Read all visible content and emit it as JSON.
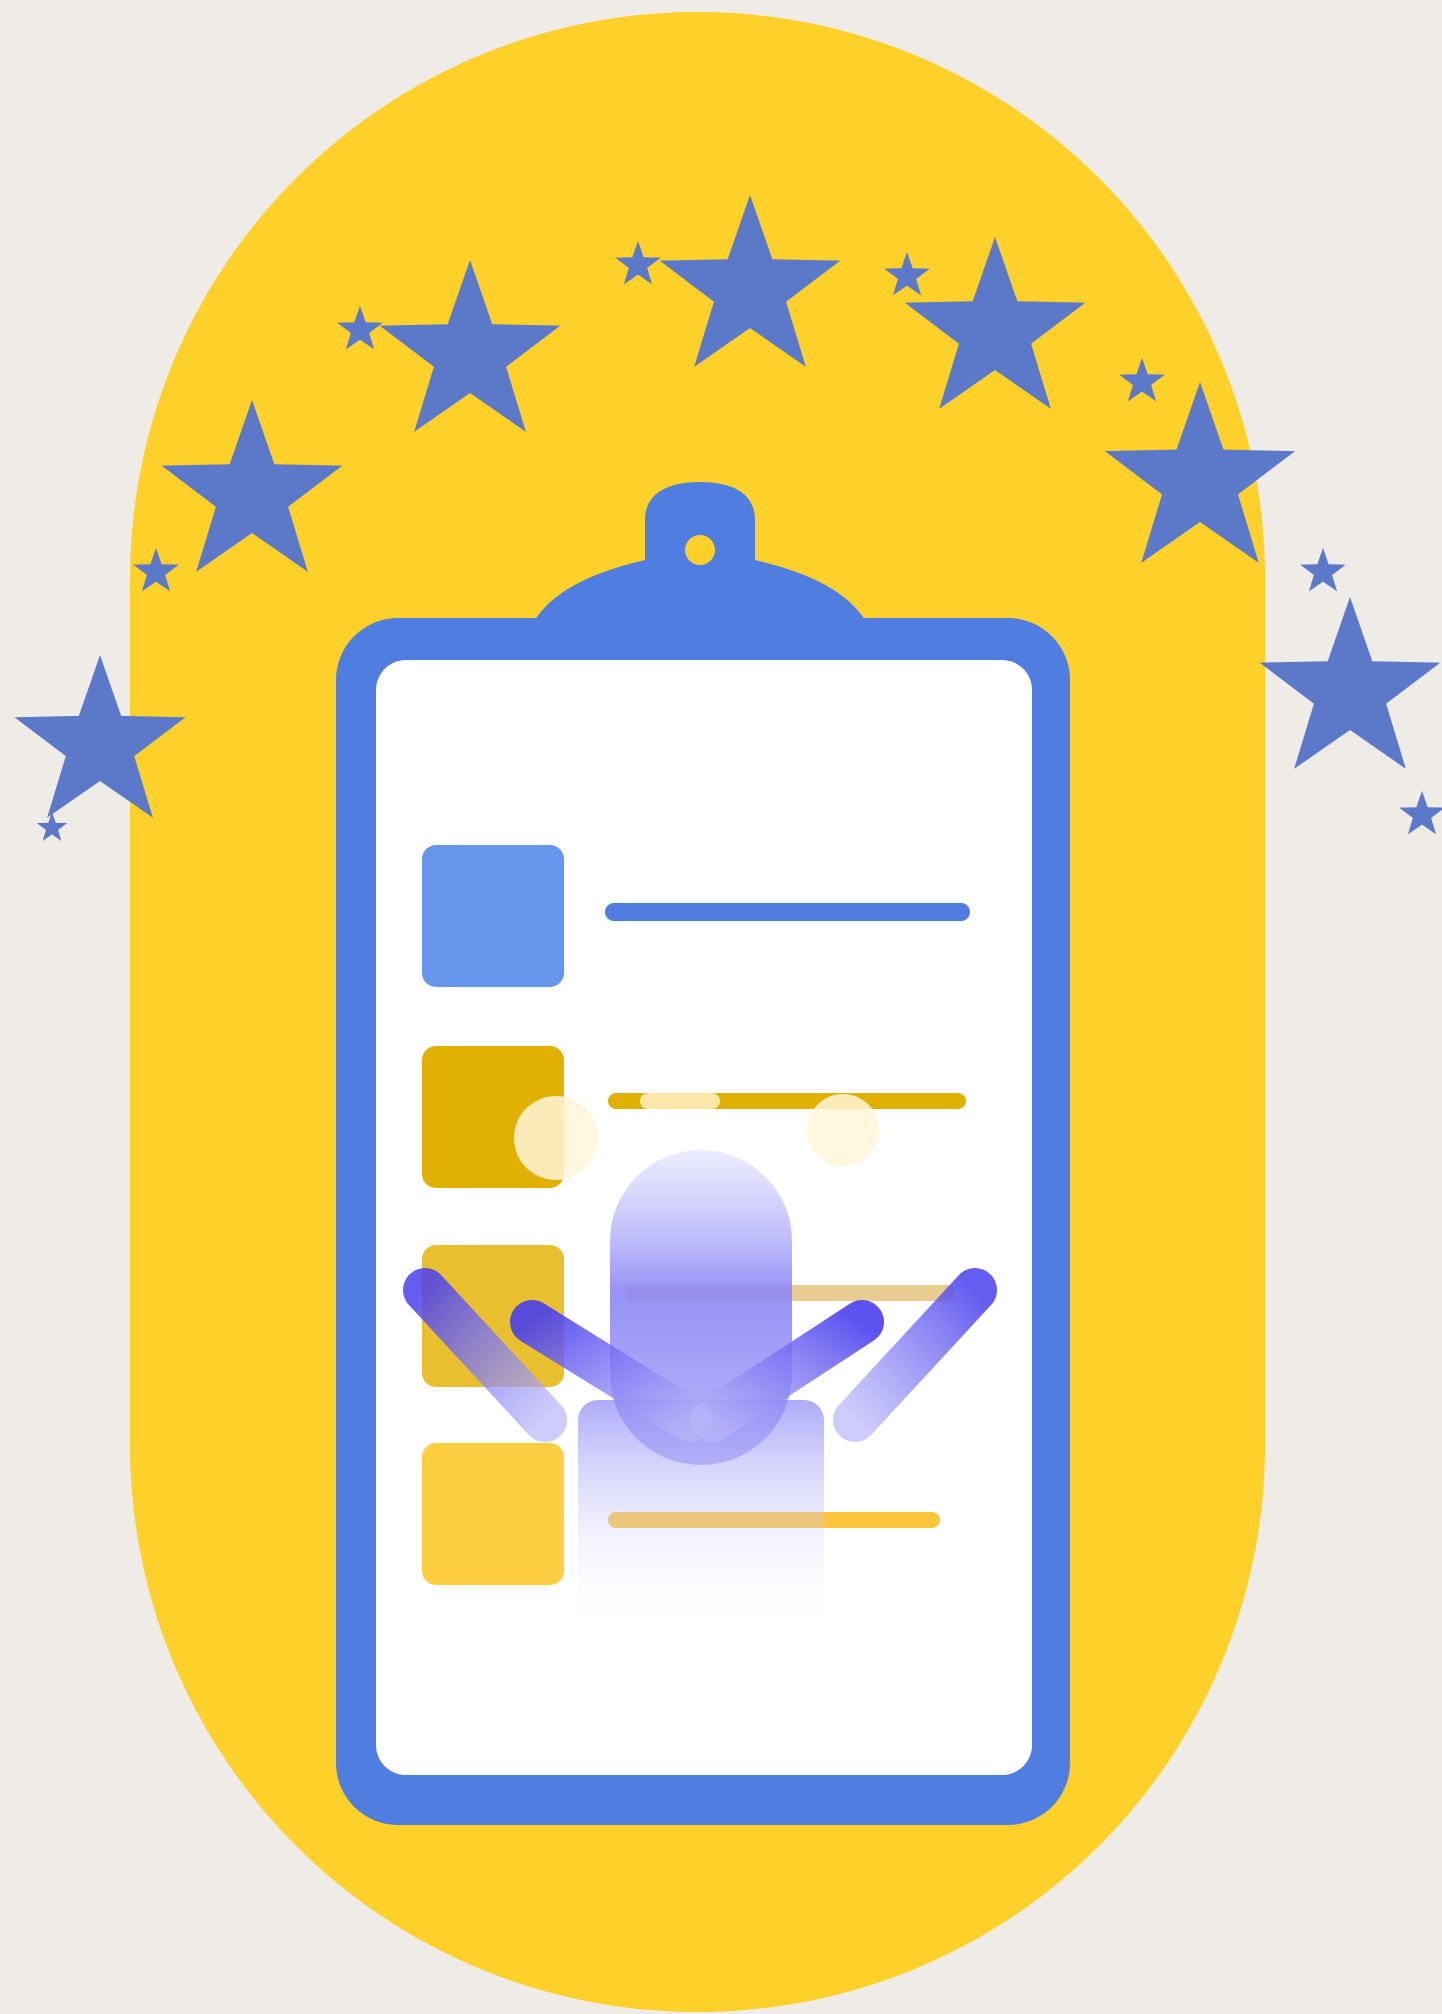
{
  "illustration": {
    "subject": "clipboard-checklist-with-stars",
    "icon": "clipboard-icon",
    "star_icon": "star-icon",
    "figure_icon": "raised-hands-icon",
    "checklist_rows": 4
  },
  "colors": {
    "background": "#efece7",
    "pill": "#fdd02a",
    "clipboard_blue": "#4f7de0",
    "paper": "#ffffff",
    "star_blue": "#5c79c9",
    "row1": "#6696ec",
    "row2": "#e0b103",
    "row3": "#e7bf2f",
    "row4": "#fdcd42",
    "figure": "#5d58f0"
  }
}
